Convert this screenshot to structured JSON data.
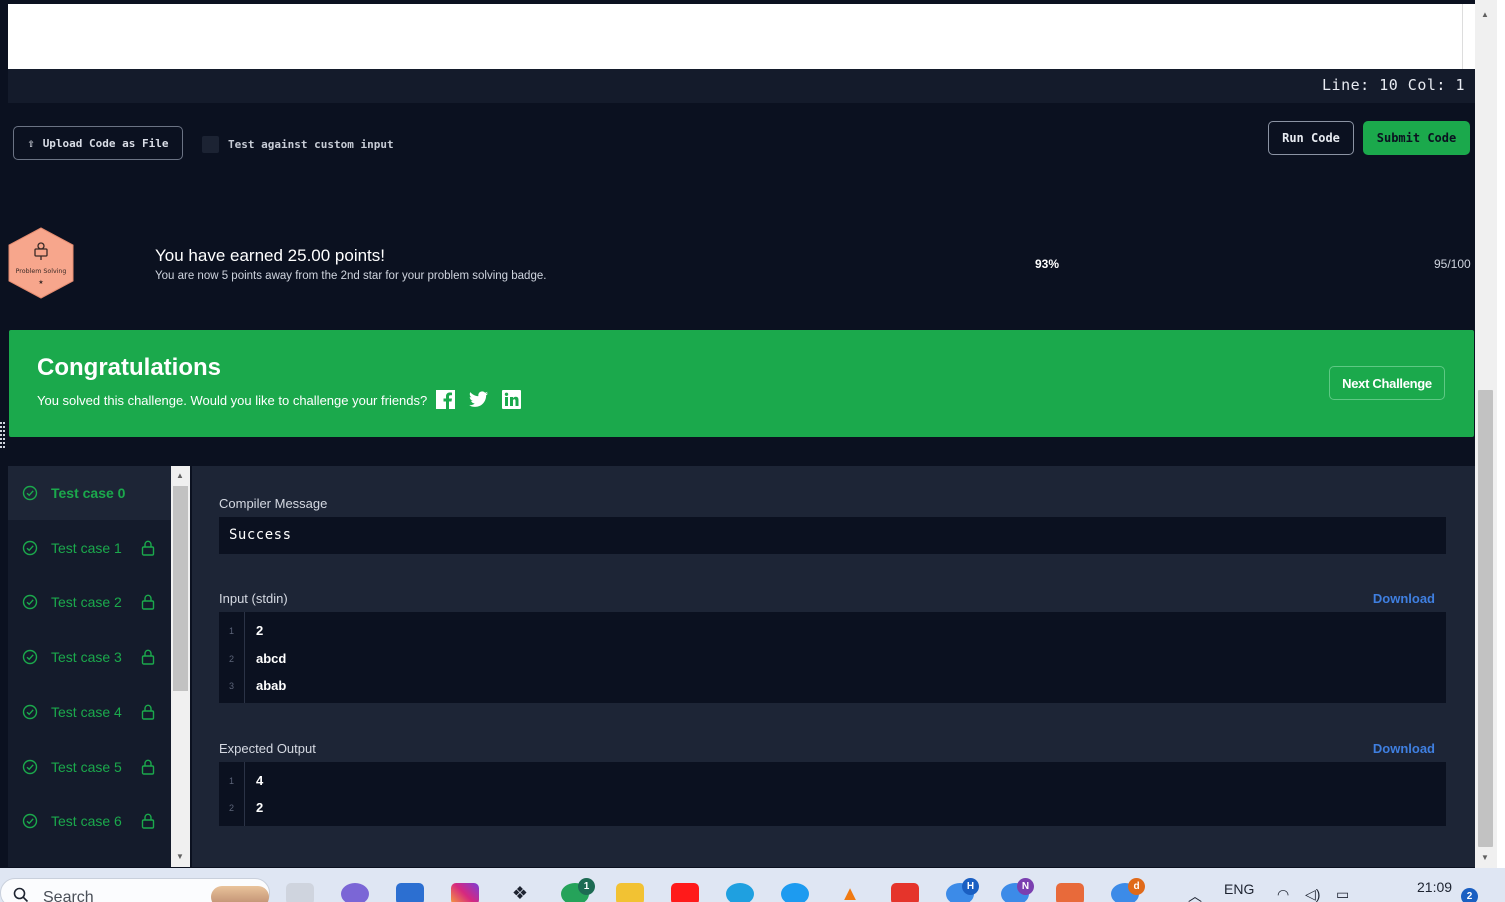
{
  "editor": {
    "status": "Line: 10 Col: 1"
  },
  "toolbar": {
    "upload_label": "Upload Code as File",
    "custom_input_label": "Test against custom input",
    "run_label": "Run Code",
    "submit_label": "Submit Code"
  },
  "badge": {
    "name": "Problem Solving",
    "star": "★"
  },
  "points": {
    "title": "You have earned 25.00 points!",
    "subtitle": "You are now 5 points away from the 2nd star for your problem solving badge.",
    "percent": "93%",
    "score": "95/100"
  },
  "congrats": {
    "title": "Congratulations",
    "message": "You solved this challenge. Would you like to challenge your friends?",
    "next_label": "Next Challenge"
  },
  "test_cases": [
    {
      "label": "Test case 0",
      "locked": false,
      "active": true
    },
    {
      "label": "Test case 1",
      "locked": true,
      "active": false
    },
    {
      "label": "Test case 2",
      "locked": true,
      "active": false
    },
    {
      "label": "Test case 3",
      "locked": true,
      "active": false
    },
    {
      "label": "Test case 4",
      "locked": true,
      "active": false
    },
    {
      "label": "Test case 5",
      "locked": true,
      "active": false
    },
    {
      "label": "Test case 6",
      "locked": true,
      "active": false
    }
  ],
  "result": {
    "compiler_label": "Compiler Message",
    "compiler_message": "Success",
    "input_label": "Input (stdin)",
    "output_label": "Expected Output",
    "download_label": "Download",
    "input_lines": [
      {
        "n": "1",
        "text": "2"
      },
      {
        "n": "2",
        "text": "abcd"
      },
      {
        "n": "3",
        "text": "abab"
      }
    ],
    "output_lines": [
      {
        "n": "1",
        "text": "4"
      },
      {
        "n": "2",
        "text": "2"
      }
    ]
  },
  "taskbar": {
    "search_placeholder": "Search",
    "language": "ENG",
    "time": "21:09",
    "whatsapp_badge": "1",
    "notification_count": "2",
    "chrome_profiles": [
      "H",
      "N",
      "d"
    ]
  },
  "colors": {
    "accent_green": "#1ba94c",
    "background": "#0b1120",
    "panel": "#1d2536",
    "link_blue": "#3f7fe0",
    "badge_orange": "#f7a68c"
  }
}
